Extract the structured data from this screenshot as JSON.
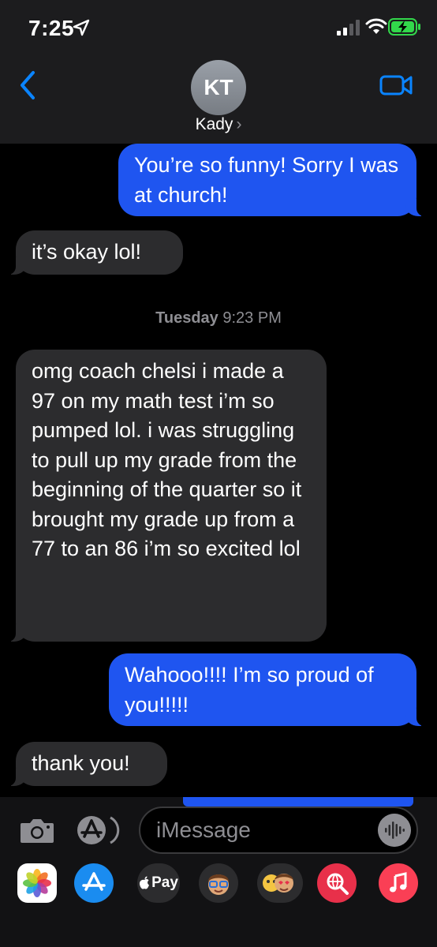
{
  "status_bar": {
    "time": "7:25"
  },
  "header": {
    "avatar_initials": "KT",
    "contact_name": "Kady",
    "chevron": "›"
  },
  "messages": [
    {
      "side": "sent",
      "text": "You’re so funny! Sorry I was at church!"
    },
    {
      "side": "received",
      "text": "it’s okay lol!"
    },
    {
      "side": "timestamp",
      "day": "Tuesday",
      "time": "9:23 PM"
    },
    {
      "side": "received",
      "text": "omg coach chelsi i made a 97 on my math test i’m so pumped lol. i was struggling to pull up my grade from the beginning of the quarter so it brought my grade up from a 77 to an 86 i’m so excited lol"
    },
    {
      "side": "sent",
      "text": "Wahooo!!!! I’m so proud of you!!!!!"
    },
    {
      "side": "received",
      "text": "thank you!"
    }
  ],
  "input": {
    "placeholder": "iMessage"
  },
  "app_drawer": {
    "apps": [
      "photos-icon",
      "app-store-icon",
      "apple-pay-icon",
      "memoji-icon",
      "animoji-stickers-icon",
      "web-search-icon",
      "music-icon"
    ],
    "apple_pay_label": "Pay"
  },
  "colors": {
    "sent_bubble": "#1f55f0",
    "received_bubble": "#2c2c2e",
    "accent": "#0a84ff",
    "header_bg": "#1c1c1e"
  }
}
